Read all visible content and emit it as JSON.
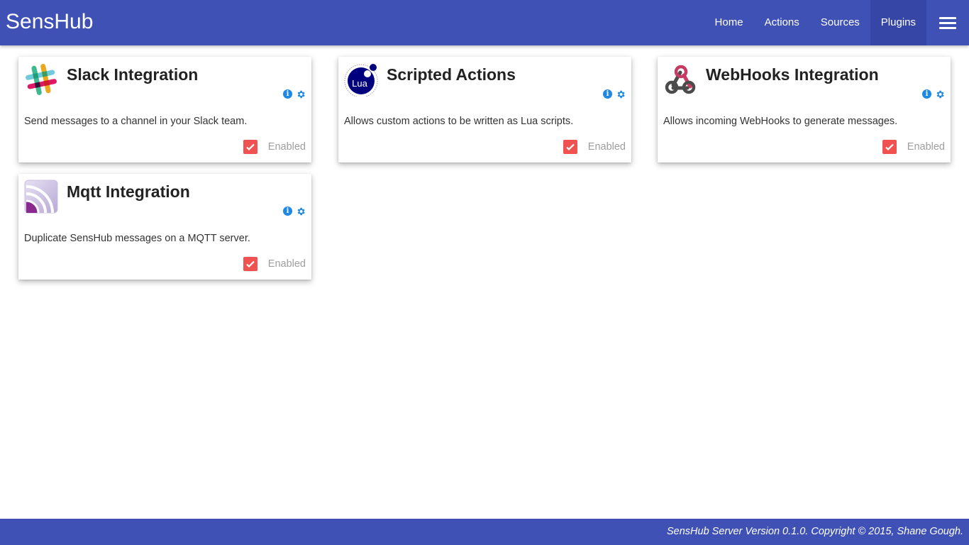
{
  "app": {
    "brand": "SensHub"
  },
  "nav": {
    "items": [
      {
        "label": "Home"
      },
      {
        "label": "Actions"
      },
      {
        "label": "Sources"
      },
      {
        "label": "Plugins"
      }
    ],
    "active": "Plugins"
  },
  "plugins": [
    {
      "title": "Slack Integration",
      "description": "Send messages to a channel in your Slack team.",
      "status_label": "Enabled",
      "icon": "slack-icon"
    },
    {
      "title": "Scripted Actions",
      "description": "Allows custom actions to be written as Lua scripts.",
      "status_label": "Enabled",
      "icon": "lua-icon",
      "logo_text": "Lua"
    },
    {
      "title": "WebHooks Integration",
      "description": "Allows incoming WebHooks to generate messages.",
      "status_label": "Enabled",
      "icon": "webhooks-icon"
    },
    {
      "title": "Mqtt Integration",
      "description": "Duplicate SensHub messages on a MQTT server.",
      "status_label": "Enabled",
      "icon": "mqtt-icon"
    }
  ],
  "footer": {
    "text": "SensHub Server Version 0.1.0. Copyright © 2015, Shane Gough."
  },
  "colors": {
    "primary": "#3f51b5",
    "active_nav": "#3546a6",
    "checkbox": "#f05252",
    "info": "#1e88e5"
  }
}
